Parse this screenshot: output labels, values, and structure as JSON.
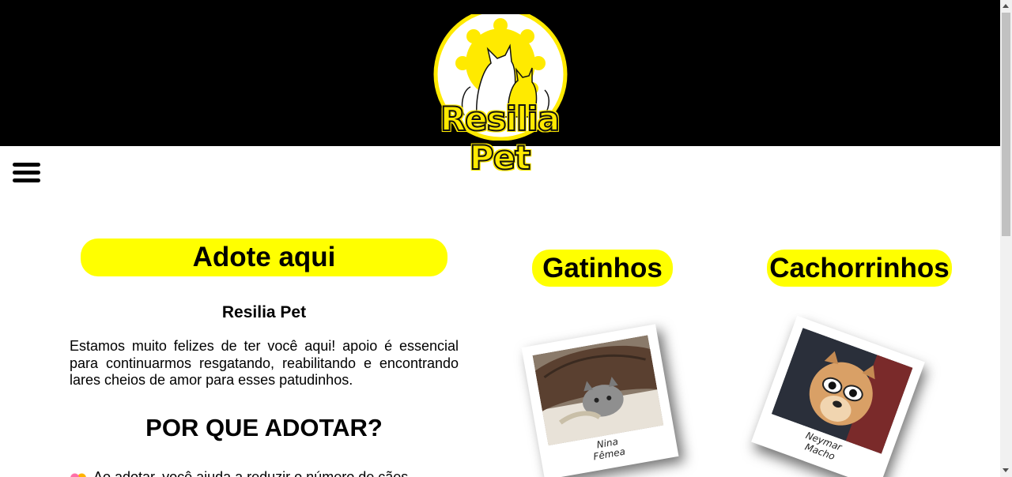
{
  "header": {
    "brand": "Resilia Pet"
  },
  "menu": {
    "icon": "hamburger-menu-icon"
  },
  "adote": {
    "title": "Adote aqui",
    "subtitle": "Resilia Pet",
    "intro": "Estamos muito felizes de ter você aqui! apoio é essencial para continuarmos resgatando, reabilitando e encontrando lares cheios de amor para esses patudinhos.",
    "why_title": "POR QUE ADOTAR?",
    "first_reason": "Ao adotar, você ajuda a reduzir o número de cães"
  },
  "cats": {
    "title": "Gatinhos",
    "pets": [
      {
        "name": "Nina",
        "sex": "Fêmea"
      }
    ]
  },
  "dogs": {
    "title": "Cachorrinhos",
    "pets": [
      {
        "name": "Neymar",
        "sex": "Macho"
      }
    ]
  },
  "colors": {
    "accent": "#ffff00",
    "header_bg": "#000000",
    "logo_yellow": "#ffea00"
  }
}
